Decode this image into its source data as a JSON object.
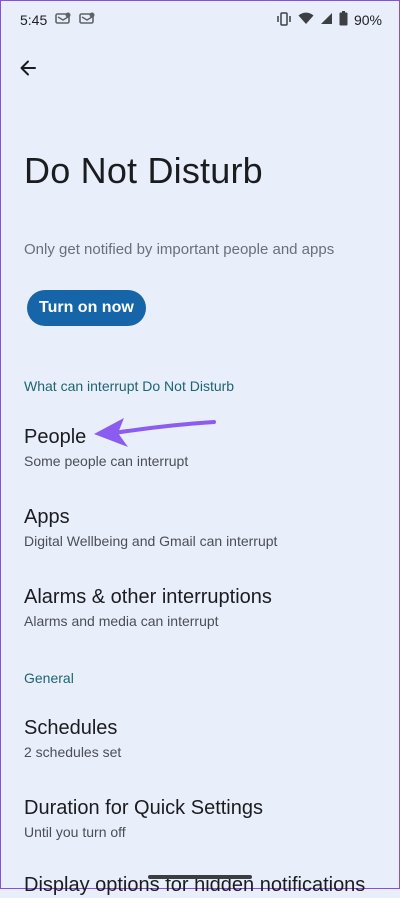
{
  "status_bar": {
    "time": "5:45",
    "battery": "90%",
    "left_icons": [
      "message-icon",
      "message-icon"
    ],
    "right_icons": [
      "vibrate-icon",
      "wifi-icon",
      "signal-icon",
      "battery-icon"
    ]
  },
  "header": {
    "back_icon": "arrow-left-icon",
    "title": "Do Not Disturb",
    "subtitle": "Only get notified by important people and apps"
  },
  "turn_on_button": {
    "label": "Turn on now"
  },
  "sections": {
    "interrupt_header": "What can interrupt Do Not Disturb",
    "general_header": "General"
  },
  "items": [
    {
      "title": "People",
      "subtitle": "Some people can interrupt"
    },
    {
      "title": "Apps",
      "subtitle": "Digital Wellbeing and Gmail can interrupt"
    },
    {
      "title": "Alarms & other interruptions",
      "subtitle": "Alarms and media can interrupt"
    },
    {
      "title": "Schedules",
      "subtitle": "2 schedules set"
    },
    {
      "title": "Duration for Quick Settings",
      "subtitle": "Until you turn off"
    },
    {
      "title": "Display options for hidden notifications",
      "subtitle": ""
    }
  ],
  "colors": {
    "background": "#e9eefb",
    "accent_button": "#1565a8",
    "section_header": "#1e6470",
    "annotation_arrow": "#8a5cf0"
  }
}
